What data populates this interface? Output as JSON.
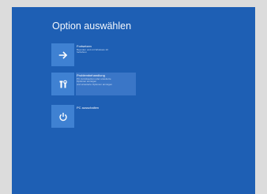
{
  "screen": {
    "title": "Option auswählen"
  },
  "options": [
    {
      "icon": "arrow-right-icon",
      "title": "Fortsetzen",
      "desc1": "Beenden und mit Windows 10",
      "desc2": "fortfahren"
    },
    {
      "icon": "tools-icon",
      "title": "Problembehandlung",
      "desc1": "PC zurücksetzen oder erweiterte",
      "desc2": "Optionen anzeigen",
      "desc3": "und erweiterte Optionen anzeigen"
    },
    {
      "icon": "power-icon",
      "title": "PC ausschalten"
    }
  ],
  "colors": {
    "background": "#1e5fb4",
    "tile": "#3f81d2",
    "highlight": "#3a76c7",
    "outer": "#dcdcdc"
  }
}
